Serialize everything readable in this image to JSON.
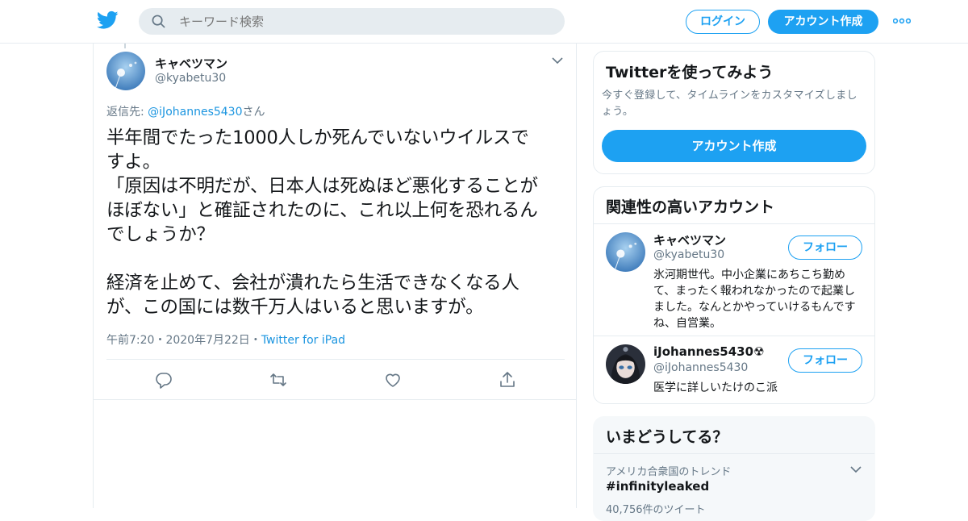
{
  "header": {
    "search_placeholder": "キーワード検索",
    "login_label": "ログイン",
    "signup_label": "アカウント作成"
  },
  "tweet": {
    "display_name": "キャベツマン",
    "handle": "@kyabetu30",
    "reply_prefix": "返信先: ",
    "reply_handle": "@iJohannes5430",
    "reply_suffix": "さん",
    "text": "半年間でたった1000人しか死んでいないウイルスで\nすよ。\n「原因は不明だが、日本人は死ぬほど悪化することが\nほぼない」と確証されたのに、これ以上何を恐れるん\nでしょうか？\n\n経済を止めて、会社が潰れたら生活できなくなる人\nが、この国には数千万人はいると思いますが。",
    "time": "午前7:20",
    "date": "2020年7月22日",
    "source": "Twitter for iPad",
    "separator": "・"
  },
  "try_twitter": {
    "title": "Twitterを使ってみよう",
    "desc": "今すぐ登録して、タイムラインをカスタマイズしましょう。",
    "button": "アカウント作成"
  },
  "related": {
    "title": "関連性の高いアカウント",
    "accounts": [
      {
        "name": "キャベツマン",
        "handle": "@kyabetu30",
        "bio": "氷河期世代。中小企業にあちこち勤めて、まったく報われなかったので起業しました。なんとかやっていけるもんですね、自営業。",
        "follow": "フォロー"
      },
      {
        "name": "iJohannes5430☢",
        "handle": "@iJohannes5430",
        "bio": "医学に詳しいたけのこ派",
        "follow": "フォロー"
      }
    ]
  },
  "trends": {
    "title": "いまどうしてる？",
    "location": "アメリカ合衆国のトレンド",
    "tag": "#infinityleaked",
    "count": "40,756件のツイート"
  },
  "colors": {
    "brand": "#1da1f2",
    "link": "#1b95e0",
    "secondary_text": "#657786",
    "border": "#e6ecf0"
  },
  "icons": [
    "twitter-logo-icon",
    "search-icon",
    "more-icon",
    "chevron-down-icon",
    "reply-icon",
    "retweet-icon",
    "like-icon",
    "share-icon"
  ]
}
